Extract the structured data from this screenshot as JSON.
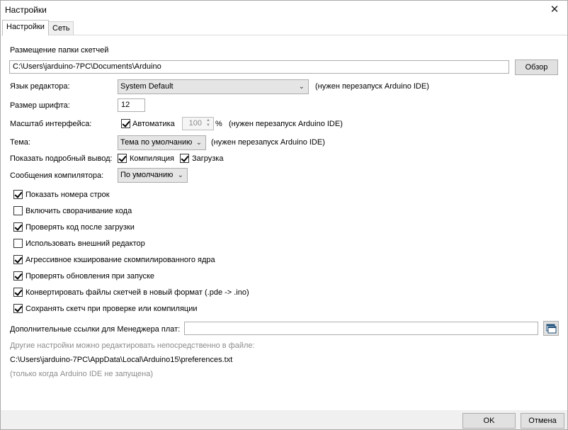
{
  "window": {
    "title": "Настройки",
    "close_icon": "close-icon"
  },
  "tabs": [
    {
      "label": "Настройки"
    },
    {
      "label": "Сеть"
    }
  ],
  "sketchbook": {
    "label": "Размещение папки скетчей",
    "path": "C:\\Users\\jarduino-7PC\\Documents\\Arduino",
    "browse": "Обзор"
  },
  "language": {
    "label": "Язык редактора:",
    "value": "System Default",
    "note": "(нужен перезапуск Arduino IDE)"
  },
  "font_size": {
    "label": "Размер шрифта:",
    "value": "12"
  },
  "scale": {
    "label": "Масштаб интерфейса:",
    "auto_label": "Автоматика",
    "auto_checked": true,
    "value": "100",
    "unit": "%",
    "note": "(нужен перезапуск Arduino IDE)"
  },
  "theme": {
    "label": "Тема:",
    "value": "Тема по умолчанию",
    "note": "(нужен перезапуск Arduino IDE)"
  },
  "verbose": {
    "label": "Показать подробный вывод:",
    "compile_label": "Компиляция",
    "compile_checked": true,
    "upload_label": "Загрузка",
    "upload_checked": true
  },
  "warnings": {
    "label": "Сообщения компилятора:",
    "value": "По умолчанию"
  },
  "options": [
    {
      "label": "Показать номера строк",
      "checked": true
    },
    {
      "label": "Включить сворачивание кода",
      "checked": false
    },
    {
      "label": "Проверять код после загрузки",
      "checked": true
    },
    {
      "label": "Использовать внешний редактор",
      "checked": false
    },
    {
      "label": "Агрессивное кэширование скомпилированного ядра",
      "checked": true
    },
    {
      "label": "Проверять обновления при запуске",
      "checked": true
    },
    {
      "label": "Конвертировать файлы скетчей в новый формат (.pde -> .ino)",
      "checked": true
    },
    {
      "label": "Сохранять скетч при проверке или компиляции",
      "checked": true
    }
  ],
  "board_urls": {
    "label": "Дополнительные ссылки для Менеджера плат:",
    "value": "",
    "button_icon": "window-list-icon"
  },
  "prefs_note": "Другие настройки можно редактировать непосредственно в файле:",
  "prefs_path": "C:\\Users\\jarduino-7PC\\AppData\\Local\\Arduino15\\preferences.txt",
  "prefs_hint": "(только когда Arduino IDE не запущена)",
  "footer": {
    "ok": "OK",
    "cancel": "Отмена"
  }
}
